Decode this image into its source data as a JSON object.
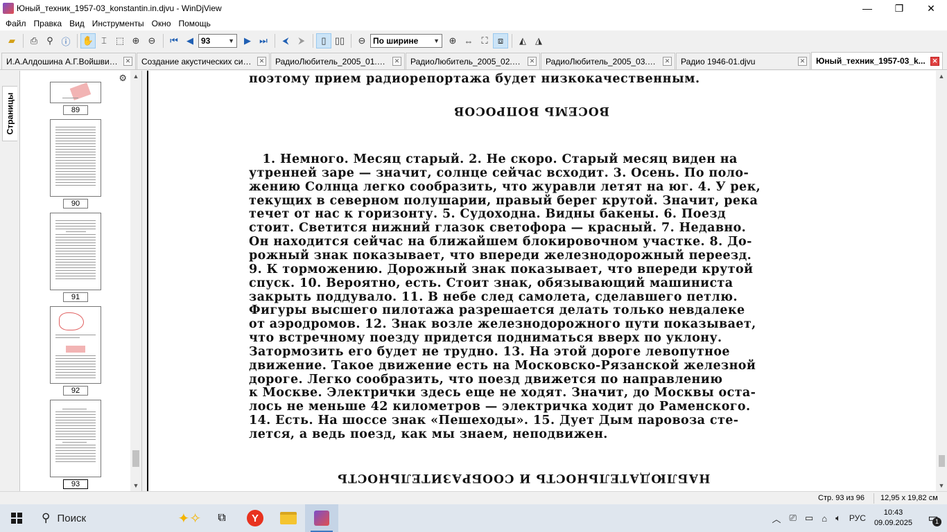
{
  "window": {
    "title": "Юный_техник_1957-03_konstantin.in.djvu - WinDjView",
    "minimize": "—",
    "maximize": "❐",
    "close": "✕"
  },
  "menu": [
    "Файл",
    "Правка",
    "Вид",
    "Инструменты",
    "Окно",
    "Помощь"
  ],
  "toolbar": {
    "page_number": "93",
    "zoom_mode": "По ширине"
  },
  "tabs": [
    {
      "label": "И.А.Алдошина А.Г.Войшвилл...",
      "active": false
    },
    {
      "label": "Создание акустических сист...",
      "active": false
    },
    {
      "label": "РадиоЛюбитель_2005_01.djvu",
      "active": false
    },
    {
      "label": "РадиоЛюбитель_2005_02.djvu",
      "active": false
    },
    {
      "label": "РадиоЛюбитель_2005_03.djvu",
      "active": false
    },
    {
      "label": "Радио 1946-01.djvu",
      "active": false
    },
    {
      "label": "Юный_техник_1957-03_k...",
      "active": true
    }
  ],
  "sidebar": {
    "tab_label": "Страницы",
    "gear_icon": "⚙",
    "close_icon": "✕",
    "thumbnails": [
      {
        "label": "89"
      },
      {
        "label": "90"
      },
      {
        "label": "91"
      },
      {
        "label": "92"
      },
      {
        "label": "93"
      }
    ]
  },
  "document": {
    "top_line": "поэтому прием радиорепортажа будет низкокачественным.",
    "heading_flipped": "ВОСЕМЬ ВОПРОСОВ",
    "body_lines": [
      "   1. Немного. Месяц старый. 2. Не скоро. Старый месяц виден на",
      "утренней заре — значит, солнце сейчас всходит. 3. Осень. По поло-",
      "жению Солнца легко сообразить, что журавли летят на юг. 4. У рек,",
      "текущих в северном полушарии, правый берег крутой. Значит, река",
      "течет от нас к горизонту. 5. Судоходна. Видны бакены. 6. Поезд",
      "стоит. Светится нижний глазок светофора — красный. 7. Недавно.",
      "Он находится сейчас на ближайшем блокировочном участке. 8. До-",
      "рожный знак показывает, что впереди железнодорожный переезд.",
      "9. К торможению. Дорожный знак показывает, что впереди крутой",
      "спуск. 10. Вероятно, есть. Стоит знак, обязывающий машиниста",
      "закрыть поддувало. 11. В небе след самолета, сделавшего петлю.",
      "Фигуры высшего пилотажа разрешается делать только невдалеке",
      "от аэродромов. 12. Знак возле железнодорожного пути показывает,",
      "что встречному поезду придется подниматься вверх по уклону.",
      "Затормозить его будет не трудно. 13. На этой дороге левопутное",
      "движение. Такое движение есть на Московско-Рязанской железной",
      "дороге. Легко сообразить, что поезд движется по направлению",
      "к Москве. Электрички здесь еще не ходят. Значит, до Москвы оста-",
      "лось не меньше 42 километров — электричка ходит до Раменского.",
      "14. Есть. На шоссе знак «Пешеходы». 15. Дует Дым паровоза сте-",
      "лется, а ведь поезд, как мы знаем, неподвижен."
    ],
    "bottom_heading_flipped": "НАБЛЮДАТЕЛЬНОСТЬ И СООБРАЗИТЕЛЬНОСТЬ"
  },
  "status": {
    "page_info": "Стр. 93 из 96",
    "page_size": "12,95 x 19,82 см"
  },
  "taskbar": {
    "search_label": "Поиск",
    "language": "РУС",
    "time": "10:43",
    "date": "09.09.2025",
    "notification_count": "1"
  }
}
